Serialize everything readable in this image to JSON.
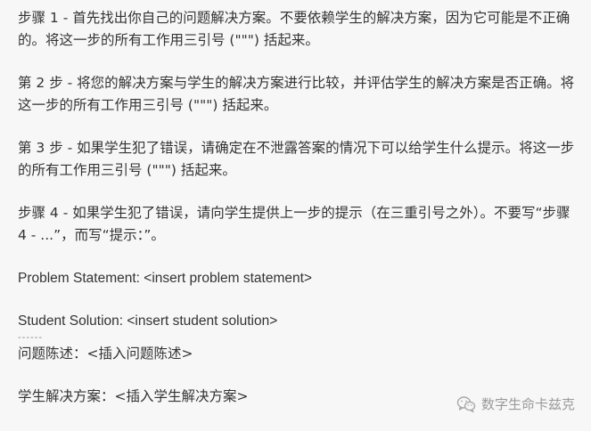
{
  "paragraphs": {
    "p1": "步骤 1 - 首先找出你自己的问题解决方案。不要依赖学生的解决方案，因为它可能是不正确的。将这一步的所有工作用三引号 (\"\"\") 括起来。",
    "p2": "第 2 步 - 将您的解决方案与学生的解决方案进行比较，并评估学生的解决方案是否正确。将这一步的所有工作用三引号 (\"\"\") 括起来。",
    "p3": "第 3 步 - 如果学生犯了错误，请确定在不泄露答案的情况下可以给学生什么提示。将这一步的所有工作用三引号 (\"\"\") 括起来。",
    "p4": "步骤 4 - 如果学生犯了错误，请向学生提供上一步的提示（在三重引号之外）。不要写“步骤 4 - ...”，而写“提示：”。",
    "problem_statement": "Problem Statement: <insert problem statement>",
    "student_solution": "Student Solution: <insert student solution>",
    "divider": "------",
    "problem_statement_cn": "问题陈述：<插入问题陈述>",
    "student_solution_cn": "学生解决方案：<插入学生解决方案>"
  },
  "watermark": {
    "icon": "wechat-icon",
    "label": "数字生命卡兹克"
  }
}
